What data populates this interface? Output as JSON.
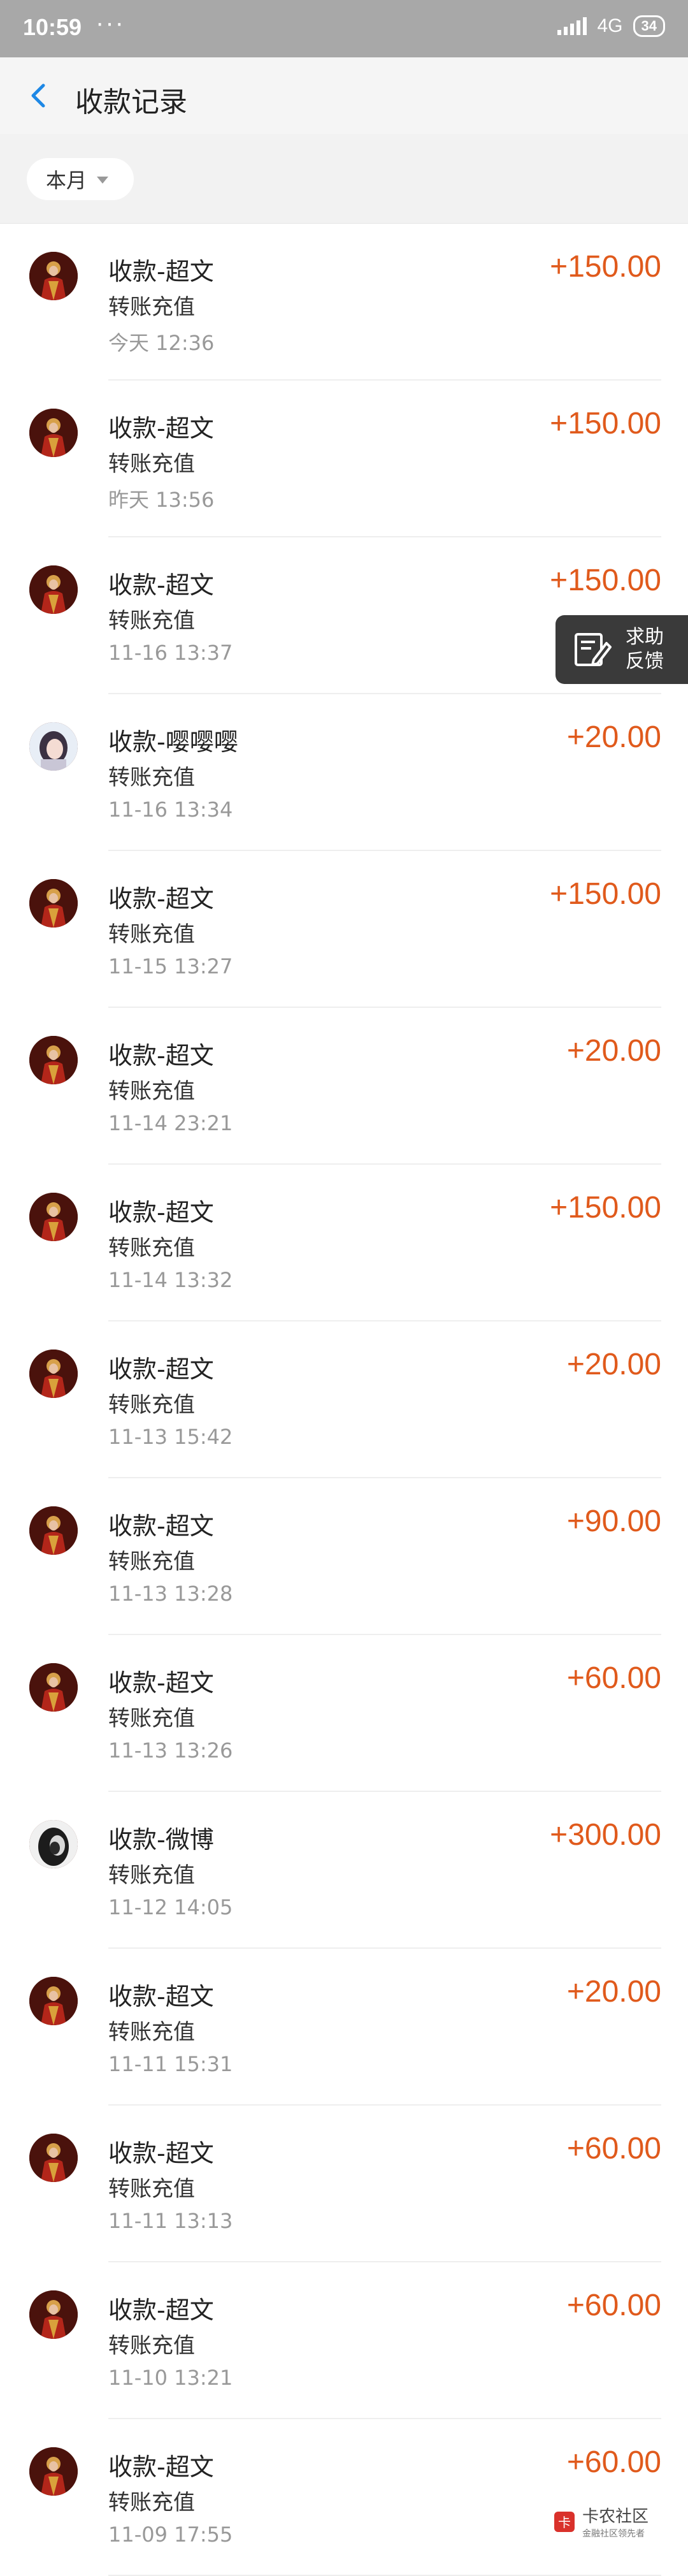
{
  "status_bar": {
    "time": "10:59",
    "dots": "···",
    "network": "4G",
    "battery": "34"
  },
  "header": {
    "title": "收款记录"
  },
  "filter": {
    "selected": "本月"
  },
  "help": {
    "line1": "求助",
    "line2": "反馈"
  },
  "watermark": {
    "title": "卡农社区",
    "subtitle": "金融社区领先者"
  },
  "colors": {
    "amount": "#e05a1c",
    "statusbar": "#a8a8a8"
  },
  "records": [
    {
      "name": "收款-超文",
      "sub": "转账充值",
      "time": "今天  12:36",
      "amount": "+150.00",
      "avatar": "red"
    },
    {
      "name": "收款-超文",
      "sub": "转账充值",
      "time": "昨天  13:56",
      "amount": "+150.00",
      "avatar": "red"
    },
    {
      "name": "收款-超文",
      "sub": "转账充值",
      "time": "11-16  13:37",
      "amount": "+150.00",
      "avatar": "red"
    },
    {
      "name": "收款-嘤嘤嘤",
      "sub": "转账充值",
      "time": "11-16  13:34",
      "amount": "+20.00",
      "avatar": "girl"
    },
    {
      "name": "收款-超文",
      "sub": "转账充值",
      "time": "11-15  13:27",
      "amount": "+150.00",
      "avatar": "red"
    },
    {
      "name": "收款-超文",
      "sub": "转账充值",
      "time": "11-14  23:21",
      "amount": "+20.00",
      "avatar": "red"
    },
    {
      "name": "收款-超文",
      "sub": "转账充值",
      "time": "11-14  13:32",
      "amount": "+150.00",
      "avatar": "red"
    },
    {
      "name": "收款-超文",
      "sub": "转账充值",
      "time": "11-13  15:42",
      "amount": "+20.00",
      "avatar": "red"
    },
    {
      "name": "收款-超文",
      "sub": "转账充值",
      "time": "11-13  13:28",
      "amount": "+90.00",
      "avatar": "red"
    },
    {
      "name": "收款-超文",
      "sub": "转账充值",
      "time": "11-13  13:26",
      "amount": "+60.00",
      "avatar": "red"
    },
    {
      "name": "收款-微博",
      "sub": "转账充值",
      "time": "11-12  14:05",
      "amount": "+300.00",
      "avatar": "dark"
    },
    {
      "name": "收款-超文",
      "sub": "转账充值",
      "time": "11-11  15:31",
      "amount": "+20.00",
      "avatar": "red"
    },
    {
      "name": "收款-超文",
      "sub": "转账充值",
      "time": "11-11  13:13",
      "amount": "+60.00",
      "avatar": "red"
    },
    {
      "name": "收款-超文",
      "sub": "转账充值",
      "time": "11-10  13:21",
      "amount": "+60.00",
      "avatar": "red"
    },
    {
      "name": "收款-超文",
      "sub": "转账充值",
      "time": "11-09  17:55",
      "amount": "+60.00",
      "avatar": "red"
    }
  ]
}
